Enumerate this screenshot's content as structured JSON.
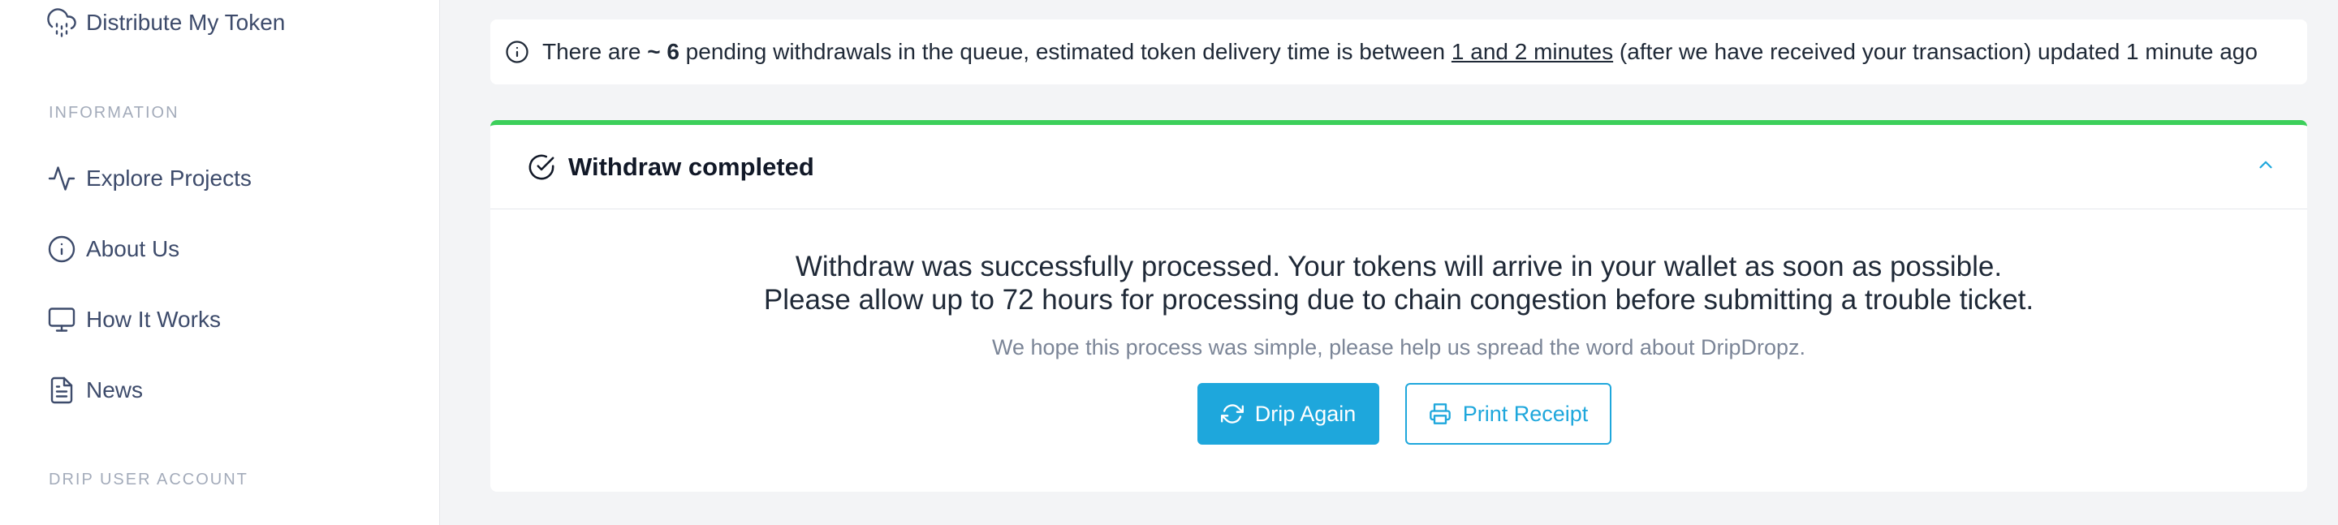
{
  "sidebar": {
    "distribute_label": "Distribute My Token",
    "information_label": "INFORMATION",
    "items": [
      {
        "label": "Explore Projects",
        "icon": "activity-icon"
      },
      {
        "label": "About Us",
        "icon": "info-icon"
      },
      {
        "label": "How It Works",
        "icon": "monitor-icon"
      },
      {
        "label": "News",
        "icon": "file-text-icon"
      }
    ],
    "account_label": "DRIP USER ACCOUNT"
  },
  "notice": {
    "prefix": "There are",
    "count": "~ 6",
    "middle": "pending withdrawals in the queue, estimated token delivery time is between",
    "range": "1 and 2 minutes",
    "suffix": "(after we have received your transaction) updated 1 minute ago"
  },
  "card": {
    "title": "Withdraw completed",
    "message_line1": "Withdraw was successfully processed. Your tokens will arrive in your wallet as soon as possible.",
    "message_line2": "Please allow up to 72 hours for processing due to chain congestion before submitting a trouble ticket.",
    "subtext": "We hope this process was simple, please help us spread the word about DripDropz.",
    "primary_button": "Drip Again",
    "secondary_button": "Print Receipt"
  },
  "colors": {
    "accent": "#1ea7dc",
    "success": "#3ccf5a",
    "sidebar_text": "#3d4b6b",
    "background": "#f3f4f6"
  }
}
